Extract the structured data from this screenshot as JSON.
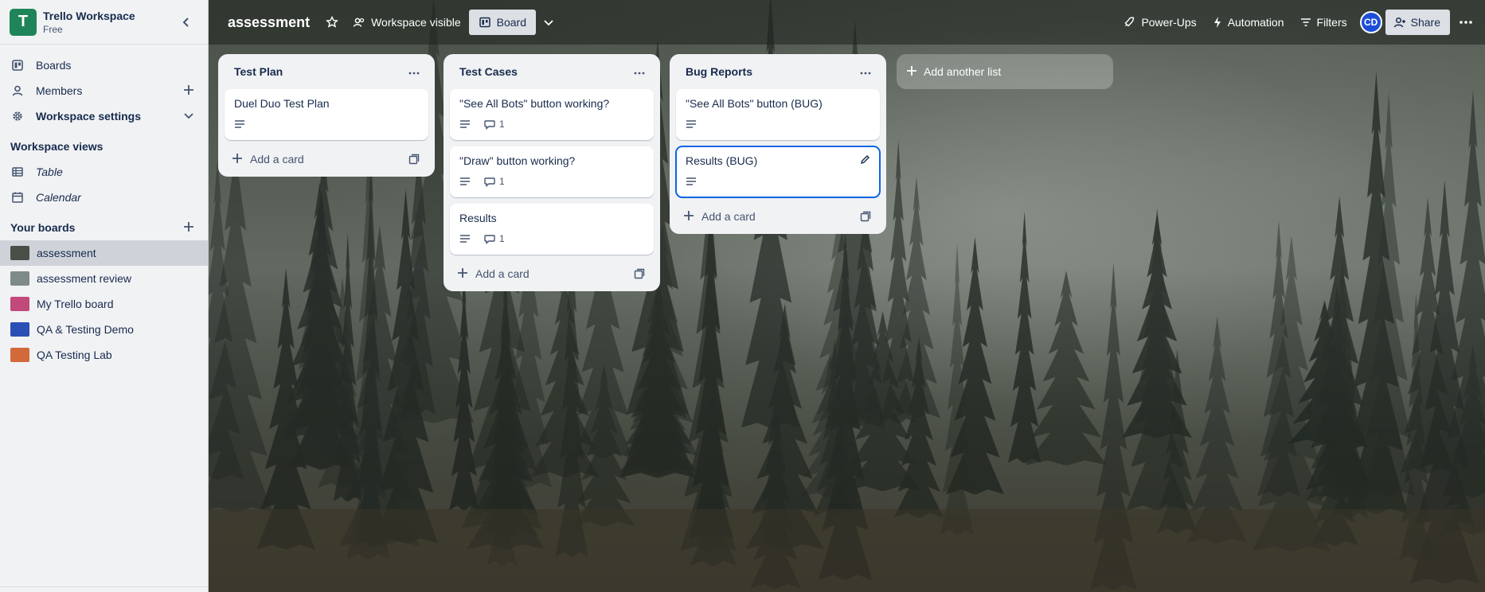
{
  "workspace": {
    "initial": "T",
    "name": "Trello Workspace",
    "plan": "Free",
    "colors": {
      "logo": "#1f845a"
    }
  },
  "sidebar": {
    "nav": [
      {
        "label": "Boards",
        "icon": "board-icon"
      },
      {
        "label": "Members",
        "icon": "person-icon",
        "right": "+"
      },
      {
        "label": "Workspace settings",
        "icon": "gear-icon",
        "right": "chevron-down"
      }
    ],
    "views_title": "Workspace views",
    "views": [
      {
        "label": "Table",
        "icon": "table-icon"
      },
      {
        "label": "Calendar",
        "icon": "calendar-icon"
      }
    ],
    "boards_title": "Your boards",
    "boards": [
      {
        "label": "assessment",
        "color": "#4a5048",
        "active": true
      },
      {
        "label": "assessment review",
        "color": "#7f8a8a"
      },
      {
        "label": "My Trello board",
        "color": "#c2497c"
      },
      {
        "label": "QA & Testing Demo",
        "color": "#2a4fb5"
      },
      {
        "label": "QA Testing Lab",
        "color": "#d2693a"
      }
    ]
  },
  "header": {
    "title": "assessment",
    "visibility": "Workspace visible",
    "view_tab": "Board",
    "power_ups": "Power-Ups",
    "automation": "Automation",
    "filters": "Filters",
    "avatar": "CD",
    "share": "Share"
  },
  "lists": [
    {
      "title": "Test Plan",
      "cards": [
        {
          "title": "Duel Duo Test Plan",
          "description": true,
          "comments": null
        }
      ],
      "add_card": "Add a card"
    },
    {
      "title": "Test Cases",
      "cards": [
        {
          "title": "\"See All Bots\" button working?",
          "description": true,
          "comments": "1"
        },
        {
          "title": "\"Draw\" button working?",
          "description": true,
          "comments": "1"
        },
        {
          "title": "Results",
          "description": true,
          "comments": "1"
        }
      ],
      "add_card": "Add a card"
    },
    {
      "title": "Bug Reports",
      "cards": [
        {
          "title": "\"See All Bots\" button (BUG)",
          "description": true,
          "comments": null
        },
        {
          "title": "Results (BUG)",
          "description": true,
          "comments": null,
          "selected": true
        }
      ],
      "add_card": "Add a card"
    }
  ],
  "add_list": "Add another list"
}
